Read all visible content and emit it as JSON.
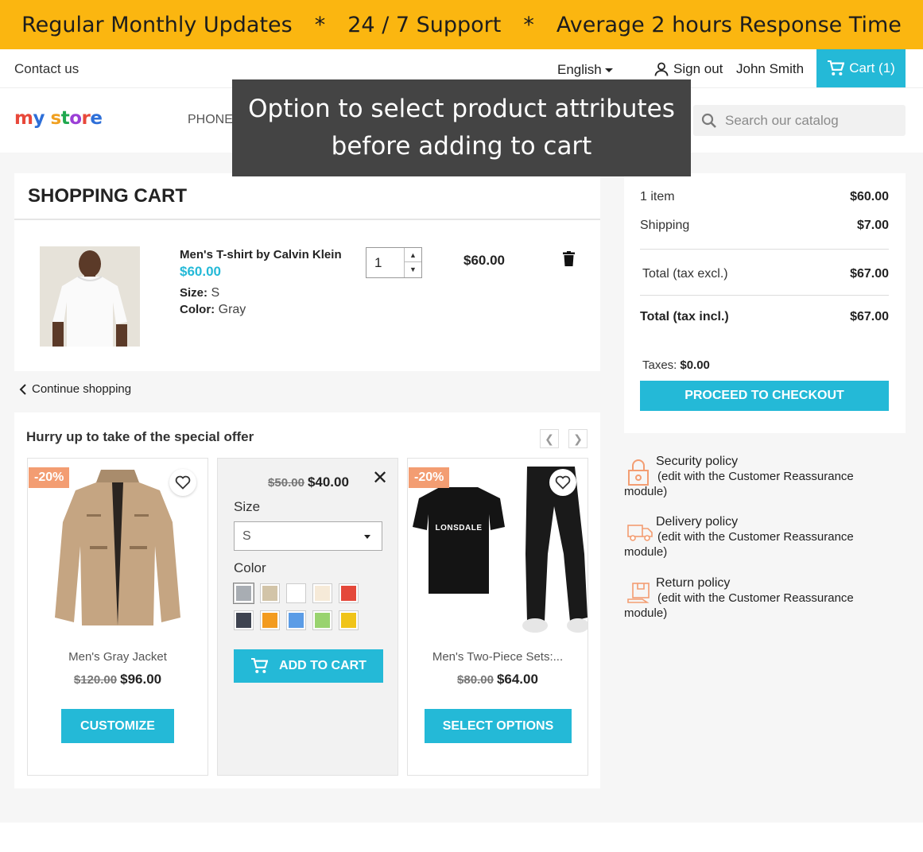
{
  "promo": {
    "item1": "Regular Monthly Updates",
    "item2": "24 / 7 Support",
    "item3": "Average 2 hours Response Time",
    "separator": "*"
  },
  "topnav": {
    "contact": "Contact us",
    "language": "English",
    "signout": "Sign out",
    "username": "John Smith",
    "cart": "Cart (1)"
  },
  "header": {
    "logo_my": "my",
    "logo_store": "store",
    "menu_phone": "PHONE",
    "search_placeholder": "Search our catalog"
  },
  "tooltip": {
    "line1": "Option to select product attributes",
    "line2": "before adding to cart"
  },
  "cart": {
    "title": "SHOPPING CART",
    "item": {
      "name": "Men's T-shirt by Calvin Klein",
      "price": "$60.00",
      "size_label": "Size:",
      "size_value": "S",
      "color_label": "Color:",
      "color_value": "Gray",
      "quantity": "1",
      "total": "$60.00"
    },
    "continue": "Continue shopping"
  },
  "offer": {
    "title": "Hurry up to take of the special offer",
    "products": [
      {
        "badge": "-20%",
        "name": "Men's Gray Jacket",
        "old_price": "$120.00",
        "price": "$96.00",
        "button": "CUSTOMIZE"
      },
      {
        "old_price": "$50.00",
        "price": "$40.00",
        "size_label": "Size",
        "size_value": "S",
        "color_label": "Color",
        "colors": [
          "#a8adb3",
          "#d2c4a8",
          "#ffffff",
          "#f6ead8",
          "#e4483a",
          "#3e4350",
          "#f39b1f",
          "#5b9ce6",
          "#99d36f",
          "#f0c419"
        ],
        "button": "ADD TO CART"
      },
      {
        "badge": "-20%",
        "name": "Men's Two-Piece Sets:...",
        "old_price": "$80.00",
        "price": "$64.00",
        "button": "SELECT OPTIONS",
        "shirt_print": "LONSDALE"
      }
    ]
  },
  "summary": {
    "items_label": "1 item",
    "items_value": "$60.00",
    "shipping_label": "Shipping",
    "shipping_value": "$7.00",
    "total_excl_label": "Total (tax excl.)",
    "total_excl_value": "$67.00",
    "total_incl_label": "Total (tax incl.)",
    "total_incl_value": "$67.00",
    "taxes_label": "Taxes:",
    "taxes_value": "$0.00",
    "checkout": "PROCEED TO CHECKOUT"
  },
  "reassurance": [
    {
      "title": "Security policy",
      "desc": "(edit with the Customer Reassurance",
      "desc2": "module)"
    },
    {
      "title": "Delivery policy",
      "desc": "(edit with the Customer Reassurance",
      "desc2": "module)"
    },
    {
      "title": "Return policy",
      "desc": "(edit with the Customer Reassurance",
      "desc2": "module)"
    }
  ],
  "colors": {
    "accent": "#24b9d7",
    "promo": "#fbb610",
    "badge": "#f39d72"
  }
}
